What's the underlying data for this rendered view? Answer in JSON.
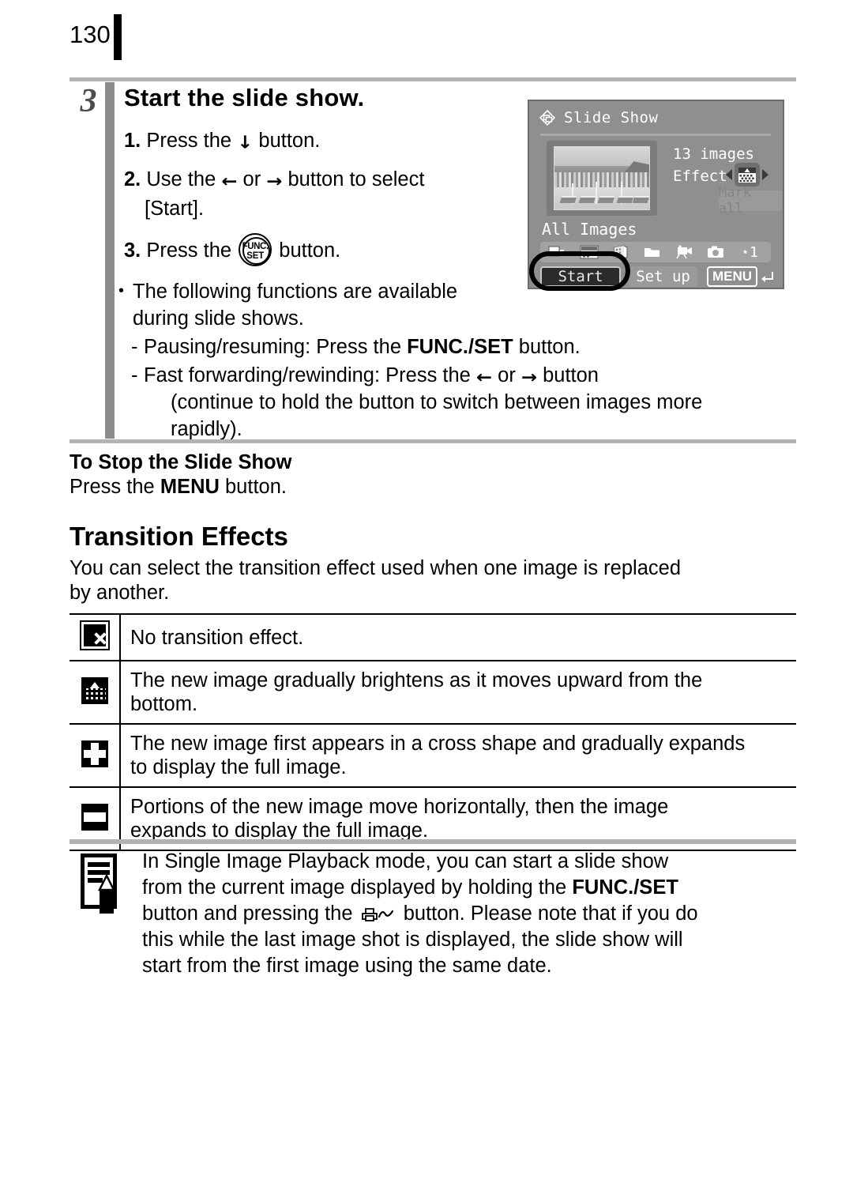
{
  "page": {
    "number": "130"
  },
  "step": {
    "index": "3",
    "title": "Start the slide show.",
    "items": [
      {
        "num": "1.",
        "pre": "Press the ",
        "glyph": "down-arrow",
        "post": " button."
      },
      {
        "num": "2.",
        "pre": "Use the ",
        "glyph": "left-arrow",
        "mid": " or ",
        "glyph2": "right-arrow",
        "post": " button to select",
        "cont": "[Start]."
      },
      {
        "num": "3.",
        "pre": "Press the ",
        "glyph": "func-set-button",
        "post": " button."
      }
    ],
    "bullet": {
      "line1": "The following functions are available",
      "line2": "during slide shows.",
      "sub1_pre": "Pausing/resuming: Press the ",
      "sub1_bold": "FUNC./SET",
      "sub1_post": " button.",
      "sub2_pre": "Fast forwarding/rewinding: Press the ",
      "sub2_mid": " or ",
      "sub2_post": " button",
      "sub2_cont1": "(continue to hold the button to switch between images more",
      "sub2_cont2": "rapidly)."
    }
  },
  "lcd": {
    "title": "Slide Show",
    "title_icon": "slide-show-icon",
    "image_count": "13 images",
    "effect_label": "Effect",
    "effect_icon": "dissolve-transition-icon",
    "mark_all": "Mark all",
    "all_images": "All Images",
    "icon_bar": [
      "images-icon",
      "date-calendar-icon",
      "film-roll-icon",
      "folder-icon",
      "movie-camera-icon",
      "still-camera-icon",
      "favorite-star-1"
    ],
    "star_label": "⋆1",
    "start_button": "Start",
    "setup_button": "Set up",
    "menu_label": "MENU",
    "menu_return_icon": "return-arrow-icon"
  },
  "stop_section": {
    "heading": "To Stop the Slide Show",
    "body_pre": "Press the ",
    "body_bold": "MENU",
    "body_post": " button."
  },
  "transition_section": {
    "heading": "Transition Effects",
    "intro_line1": "You can select the transition effect used when one image is replaced",
    "intro_line2": "by another.",
    "rows": [
      {
        "icon": "no-transition-icon",
        "line1": "No transition effect.",
        "line2": ""
      },
      {
        "icon": "dissolve-up-transition-icon",
        "line1": "The new image gradually brightens as it moves upward from the",
        "line2": "bottom."
      },
      {
        "icon": "cross-transition-icon",
        "line1": "The new image first appears in a cross shape and gradually expands",
        "line2": "to display the full image."
      },
      {
        "icon": "horizontal-band-transition-icon",
        "line1": "Portions of the new image move horizontally, then the image",
        "line2": "expands to display the full image."
      }
    ]
  },
  "note": {
    "icon": "note-memo-pencil-icon",
    "line1": "In Single Image Playback mode, you can start a slide show",
    "line2_pre": "from the current image displayed by holding the ",
    "line2_bold": "FUNC./SET",
    "line3_pre": "button and pressing the ",
    "line3_glyph": "print-share-button-icon",
    "line3_post": " button. Please note that if you do",
    "line4": "this while the last image shot is displayed, the slide show will",
    "line5": "start from the first image using the same date."
  },
  "colors": {
    "rule_gray": "#b3b3b3",
    "step_bar_gray": "#8c8c8c",
    "step_num_gray": "#4d4d4d",
    "lcd_bg": "#8f8f8f",
    "lcd_text": "#ffffff",
    "lcd_disabled": "#848484",
    "ink": "#000000"
  }
}
